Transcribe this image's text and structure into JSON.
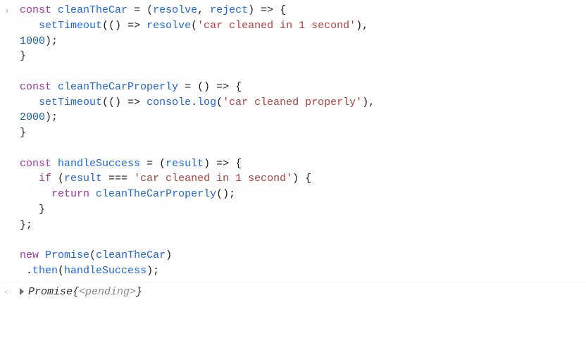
{
  "input": {
    "tokens": [
      [
        {
          "c": "kw",
          "t": "const"
        },
        {
          "c": "plain",
          "t": " "
        },
        {
          "c": "fn",
          "t": "cleanTheCar"
        },
        {
          "c": "plain",
          "t": " "
        },
        {
          "c": "op",
          "t": "="
        },
        {
          "c": "plain",
          "t": " ("
        },
        {
          "c": "var",
          "t": "resolve"
        },
        {
          "c": "plain",
          "t": ", "
        },
        {
          "c": "var",
          "t": "reject"
        },
        {
          "c": "plain",
          "t": ") "
        },
        {
          "c": "op",
          "t": "=>"
        },
        {
          "c": "plain",
          "t": " {"
        }
      ],
      [
        {
          "c": "plain",
          "t": "   "
        },
        {
          "c": "fn",
          "t": "setTimeout"
        },
        {
          "c": "plain",
          "t": "(() "
        },
        {
          "c": "op",
          "t": "=>"
        },
        {
          "c": "plain",
          "t": " "
        },
        {
          "c": "fn",
          "t": "resolve"
        },
        {
          "c": "plain",
          "t": "("
        },
        {
          "c": "str",
          "t": "'car cleaned in 1 second'"
        },
        {
          "c": "plain",
          "t": "), "
        }
      ],
      [
        {
          "c": "num",
          "t": "1000"
        },
        {
          "c": "plain",
          "t": ");"
        }
      ],
      [
        {
          "c": "plain",
          "t": "}"
        }
      ],
      [
        {
          "c": "plain",
          "t": ""
        }
      ],
      [
        {
          "c": "kw",
          "t": "const"
        },
        {
          "c": "plain",
          "t": " "
        },
        {
          "c": "fn",
          "t": "cleanTheCarProperly"
        },
        {
          "c": "plain",
          "t": " "
        },
        {
          "c": "op",
          "t": "="
        },
        {
          "c": "plain",
          "t": " () "
        },
        {
          "c": "op",
          "t": "=>"
        },
        {
          "c": "plain",
          "t": " {"
        }
      ],
      [
        {
          "c": "plain",
          "t": "   "
        },
        {
          "c": "fn",
          "t": "setTimeout"
        },
        {
          "c": "plain",
          "t": "(() "
        },
        {
          "c": "op",
          "t": "=>"
        },
        {
          "c": "plain",
          "t": " "
        },
        {
          "c": "glob",
          "t": "console"
        },
        {
          "c": "plain",
          "t": "."
        },
        {
          "c": "fn",
          "t": "log"
        },
        {
          "c": "plain",
          "t": "("
        },
        {
          "c": "str",
          "t": "'car cleaned properly'"
        },
        {
          "c": "plain",
          "t": "), "
        }
      ],
      [
        {
          "c": "num",
          "t": "2000"
        },
        {
          "c": "plain",
          "t": ");"
        }
      ],
      [
        {
          "c": "plain",
          "t": "}"
        }
      ],
      [
        {
          "c": "plain",
          "t": ""
        }
      ],
      [
        {
          "c": "kw",
          "t": "const"
        },
        {
          "c": "plain",
          "t": " "
        },
        {
          "c": "fn",
          "t": "handleSuccess"
        },
        {
          "c": "plain",
          "t": " "
        },
        {
          "c": "op",
          "t": "="
        },
        {
          "c": "plain",
          "t": " ("
        },
        {
          "c": "var",
          "t": "result"
        },
        {
          "c": "plain",
          "t": ") "
        },
        {
          "c": "op",
          "t": "=>"
        },
        {
          "c": "plain",
          "t": " {"
        }
      ],
      [
        {
          "c": "plain",
          "t": "   "
        },
        {
          "c": "kw",
          "t": "if"
        },
        {
          "c": "plain",
          "t": " ("
        },
        {
          "c": "var",
          "t": "result"
        },
        {
          "c": "plain",
          "t": " "
        },
        {
          "c": "op",
          "t": "==="
        },
        {
          "c": "plain",
          "t": " "
        },
        {
          "c": "str",
          "t": "'car cleaned in 1 second'"
        },
        {
          "c": "plain",
          "t": ") {"
        }
      ],
      [
        {
          "c": "plain",
          "t": "     "
        },
        {
          "c": "kw",
          "t": "return"
        },
        {
          "c": "plain",
          "t": " "
        },
        {
          "c": "fn",
          "t": "cleanTheCarProperly"
        },
        {
          "c": "plain",
          "t": "();"
        }
      ],
      [
        {
          "c": "plain",
          "t": "   }"
        }
      ],
      [
        {
          "c": "plain",
          "t": "};"
        }
      ],
      [
        {
          "c": "plain",
          "t": ""
        }
      ],
      [
        {
          "c": "kw",
          "t": "new"
        },
        {
          "c": "plain",
          "t": " "
        },
        {
          "c": "glob",
          "t": "Promise"
        },
        {
          "c": "plain",
          "t": "("
        },
        {
          "c": "var",
          "t": "cleanTheCar"
        },
        {
          "c": "plain",
          "t": ")"
        }
      ],
      [
        {
          "c": "plain",
          "t": " ."
        },
        {
          "c": "fn",
          "t": "then"
        },
        {
          "c": "plain",
          "t": "("
        },
        {
          "c": "var",
          "t": "handleSuccess"
        },
        {
          "c": "plain",
          "t": ");"
        }
      ]
    ]
  },
  "output": {
    "label": "Promise ",
    "brace_open": "{",
    "state": "<pending>",
    "brace_close": "}",
    "gutter_symbol": "<·"
  }
}
